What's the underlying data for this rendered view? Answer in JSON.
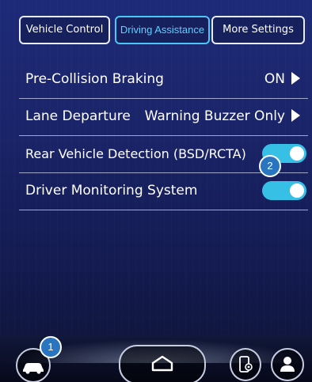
{
  "tabs": [
    {
      "label": "Vehicle Control"
    },
    {
      "label": "Driving Assistance"
    },
    {
      "label": "More Settings"
    }
  ],
  "rows": [
    {
      "label": "Pre-Collision Braking",
      "value": "ON"
    },
    {
      "label": "Lane Departure",
      "value": "Warning Buzzer Only"
    },
    {
      "label": "Rear Vehicle Detection (BSD/RCTA)",
      "toggle": "on"
    },
    {
      "label": "Driver Monitoring System",
      "toggle": "on"
    }
  ],
  "badges": {
    "one": "1",
    "two": "2"
  },
  "colors": {
    "accent": "#36c0e6",
    "tab_active": "#5fd0ff",
    "background": "#1a2468",
    "badge": "#2a75bf"
  },
  "icons": {
    "car": "car-icon",
    "home": "home-icon",
    "phone_settings": "phone-settings-icon",
    "user": "user-icon",
    "arrow": "play-arrow-icon"
  }
}
